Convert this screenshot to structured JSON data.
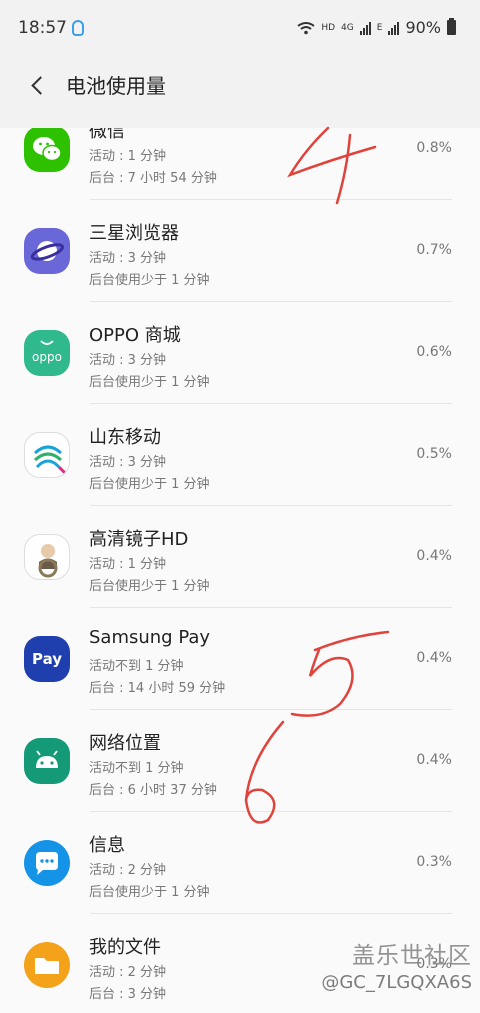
{
  "status_bar": {
    "time": "18:57",
    "network_labels": [
      "HD",
      "4G",
      "E"
    ],
    "battery": "90%"
  },
  "header": {
    "back_icon": "back-arrow-icon",
    "title": "电池使用量"
  },
  "apps": [
    {
      "name": "微信",
      "line1": "活动 : 1 分钟",
      "line2": "后台 : 7 小时 54 分钟",
      "percent": "0.8%",
      "icon": "wechat-icon"
    },
    {
      "name": "三星浏览器",
      "line1": "活动 : 3 分钟",
      "line2": "后台使用少于 1 分钟",
      "percent": "0.7%",
      "icon": "samsung-browser-icon"
    },
    {
      "name": "OPPO 商城",
      "line1": "活动 : 3 分钟",
      "line2": "后台使用少于 1 分钟",
      "percent": "0.6%",
      "icon": "oppo-store-icon",
      "icon_text": "oppo"
    },
    {
      "name": "山东移动",
      "line1": "活动 : 3 分钟",
      "line2": "后台使用少于 1 分钟",
      "percent": "0.5%",
      "icon": "china-mobile-icon"
    },
    {
      "name": "高清镜子HD",
      "line1": "活动 : 1 分钟",
      "line2": "后台使用少于 1 分钟",
      "percent": "0.4%",
      "icon": "mirror-app-icon"
    },
    {
      "name": "Samsung Pay",
      "line1": "活动不到 1 分钟",
      "line2": "后台 : 14 小时 59 分钟",
      "percent": "0.4%",
      "icon": "samsung-pay-icon",
      "icon_text": "Pay"
    },
    {
      "name": "网络位置",
      "line1": "活动不到 1 分钟",
      "line2": "后台 : 6 小时 37 分钟",
      "percent": "0.4%",
      "icon": "android-icon"
    },
    {
      "name": "信息",
      "line1": "活动 : 2 分钟",
      "line2": "后台使用少于 1 分钟",
      "percent": "0.3%",
      "icon": "messages-icon"
    },
    {
      "name": "我的文件",
      "line1": "活动 : 2 分钟",
      "line2": "后台 : 3 分钟",
      "percent": "0.3%",
      "icon": "my-files-icon"
    }
  ],
  "handwriting": [
    "4",
    "5",
    "6"
  ],
  "watermark": {
    "brand": "盖乐世社区",
    "user": "@GC_7LGQXA6S"
  },
  "colors": {
    "annotation_red": "#e0433b",
    "header_bg": "#f2f2f2"
  }
}
